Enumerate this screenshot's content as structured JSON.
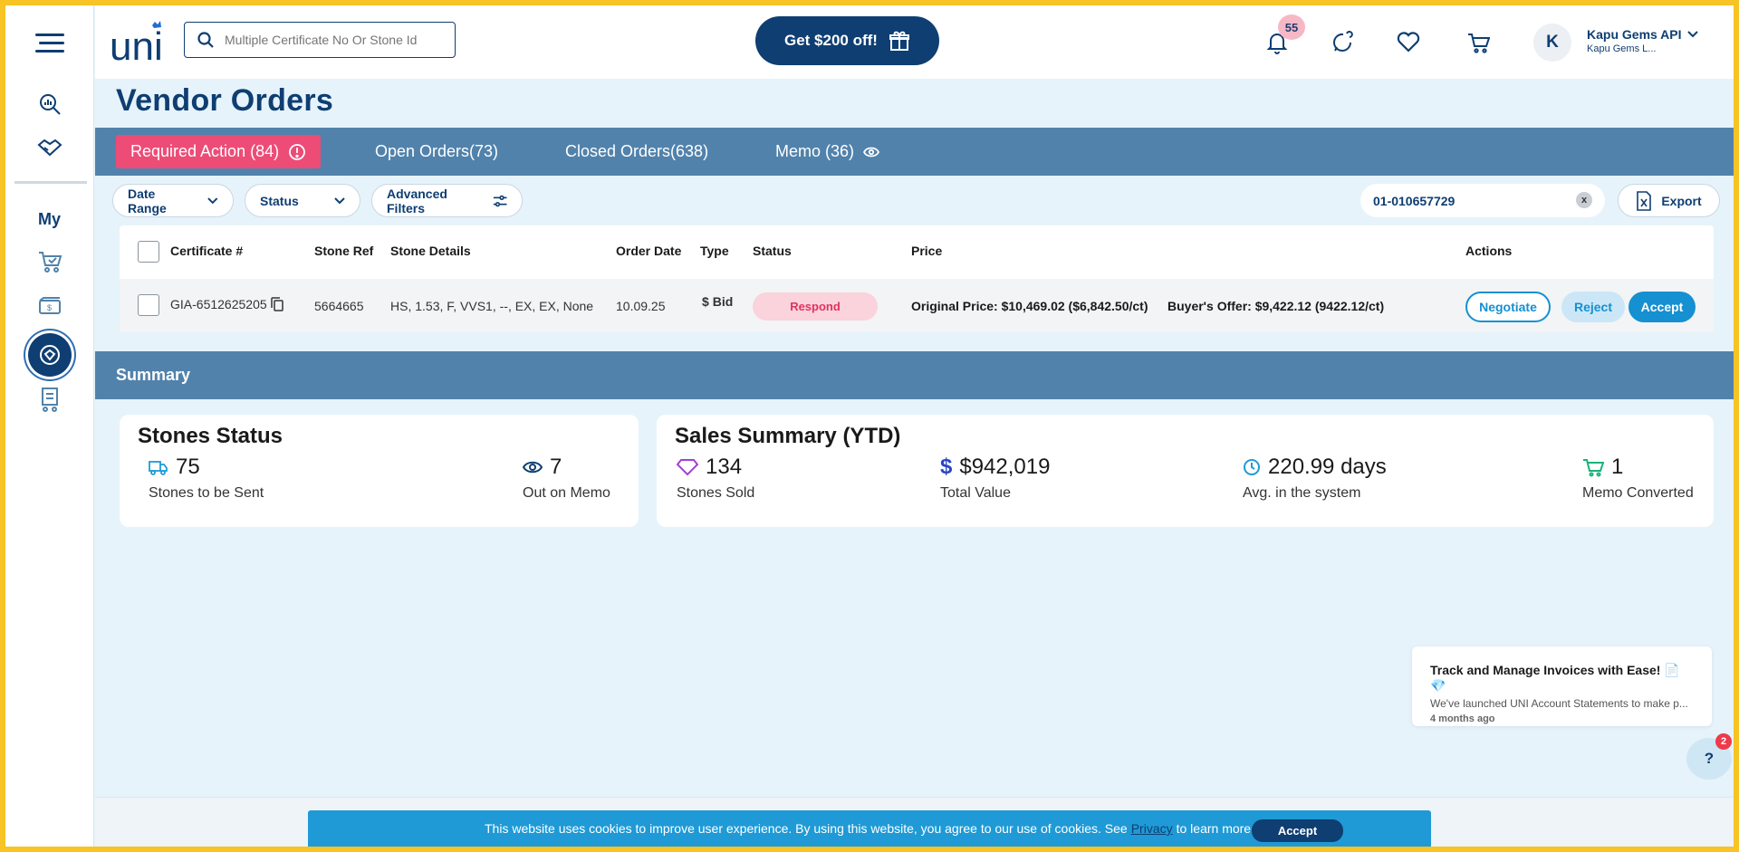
{
  "header": {
    "search_placeholder": "Multiple Certificate No Or Stone Id",
    "promo_label": "Get $200 off!",
    "notification_count": "55",
    "user_initial": "K",
    "user_name": "Kapu Gems API",
    "user_company": "Kapu Gems L..."
  },
  "sidebar": {
    "my_label": "My"
  },
  "page": {
    "title": "Vendor Orders"
  },
  "tabs": [
    {
      "label": "Required Action (84)"
    },
    {
      "label": "Open Orders(73)"
    },
    {
      "label": "Closed Orders(638)"
    },
    {
      "label": "Memo (36)"
    }
  ],
  "filters": {
    "date_range": "Date Range",
    "status": "Status",
    "advanced": "Advanced Filters",
    "search_value": "01-010657729",
    "clear_label": "x",
    "export_label": "Export"
  },
  "table": {
    "columns": [
      "Certificate #",
      "Stone Ref",
      "Stone Details",
      "Order Date",
      "Type",
      "Status",
      "Price",
      "Actions"
    ],
    "rows": [
      {
        "certificate": "GIA-6512625205",
        "stone_ref": "5664665",
        "details": "HS, 1.53, F, VVS1, --, EX, EX, None",
        "order_date": "10.09.25",
        "type": "Bid",
        "status": "Respond",
        "original_price": "Original Price: $10,469.02 ($6,842.50/ct)",
        "buyer_offer": "Buyer's Offer: $9,422.12 (9422.12/ct)",
        "actions": {
          "negotiate": "Negotiate",
          "reject": "Reject",
          "accept": "Accept"
        }
      }
    ]
  },
  "summary": {
    "title": "Summary",
    "stones_status": {
      "title": "Stones Status",
      "to_be_sent_value": "75",
      "to_be_sent_label": "Stones to be Sent",
      "out_on_memo_value": "7",
      "out_on_memo_label": "Out on Memo"
    },
    "sales_summary": {
      "title": "Sales Summary (YTD)",
      "stones_sold_value": "134",
      "stones_sold_label": "Stones Sold",
      "total_value_value": "$942,019",
      "total_value_label": "Total Value",
      "avg_days_value": "220.99 days",
      "avg_days_label": "Avg. in the system",
      "memo_converted_value": "1",
      "memo_converted_label": "Memo Converted"
    }
  },
  "toast": {
    "title": "Track and Manage Invoices with Ease! 📄💎",
    "body": "We've launched UNI Account Statements to make p...",
    "time": "4 months ago"
  },
  "help": {
    "label": "?",
    "badge": "2"
  },
  "cookie": {
    "text": "This website uses cookies to improve user experience. By using this website, you agree to our use of cookies. See",
    "link": "Privacy",
    "suffix": "to learn more.",
    "accept": "Accept"
  },
  "colors": {
    "brand": "#0e3e72",
    "accent": "#ed4c77",
    "tabbar": "#5182ab",
    "info": "#1f9ad6"
  }
}
